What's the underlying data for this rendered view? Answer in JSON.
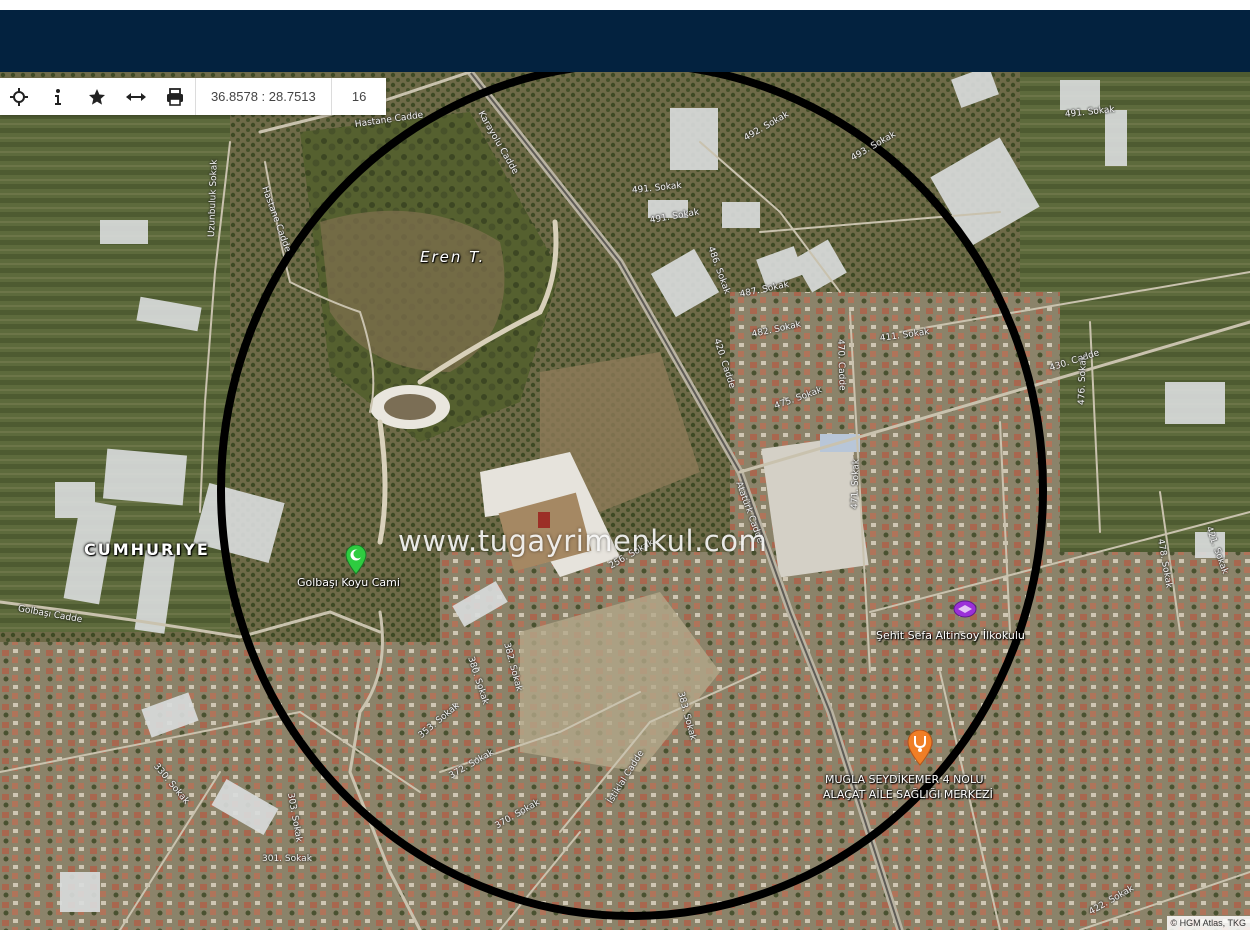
{
  "toolbar": {
    "locate_icon": "crosshair-icon",
    "info_icon": "info-icon",
    "favorite_icon": "star-icon",
    "measure_icon": "measure-arrows-icon",
    "print_icon": "printer-icon",
    "coordinates": "36.8578 : 28.7513",
    "zoom": "16"
  },
  "colors": {
    "header": "#03223f",
    "ring": "#000000",
    "mosque_marker": "#2ecc40",
    "school_marker": "#9b30d9",
    "health_marker": "#f07e26"
  },
  "map": {
    "area_label": "CUMHURIYE",
    "hill_label": "Eren T.",
    "watermark": "www.tugayrimenkul.com",
    "pois": {
      "mosque": "Golbaşı Koyu Cami",
      "school": "Şehit Sefa Altinsoy İlkokulu",
      "health_line1": "MUGLA SEYDİKEMER 4 NOLU",
      "health_line2": "ALAÇAT AİLE SAĞLIĞI MERKEZİ"
    },
    "streets": {
      "hastane_cadde": "Hastane Cadde",
      "hastane_cadde_v": "Hastane Cadde",
      "uzunbuluk": "Uzunbuluk Sokak",
      "karayolu": "Karayolu Cadde",
      "s491a": "491. Sokak",
      "s491b": "491. Sokak",
      "s491c": "491. Sokak",
      "s492": "492. Sokak",
      "s493": "493. Sokak",
      "s487": "487. Sokak",
      "s486": "486. Sokak",
      "c420": "420. Cadde",
      "s482": "482. Sokak",
      "s411": "411. Sokak",
      "c430": "430. Cadde",
      "c470": "470. Cadde",
      "s475": "475. Sokak",
      "s476": "476. Sokak",
      "istiklal": "İstiklal Cadde",
      "golbasi": "Golbaşı Cadde",
      "c471": "471. Sokak",
      "s421": "421. Sokak",
      "s478": "478. Sokak",
      "s380": "380. Sokak",
      "s382": "382. Sokak",
      "s383": "383. Sokak",
      "s372": "372. Sokak",
      "s370": "370. Sokak",
      "s301": "301. Sokak",
      "s303": "303. Sokak",
      "s330": "330. Sokak",
      "s422": "422. Sokak",
      "s256": "256. Sokak",
      "s353": "353. Sokak",
      "atatürk": "Atatürk Cadde"
    },
    "attribution": "© HGM Atlas, TKG"
  }
}
